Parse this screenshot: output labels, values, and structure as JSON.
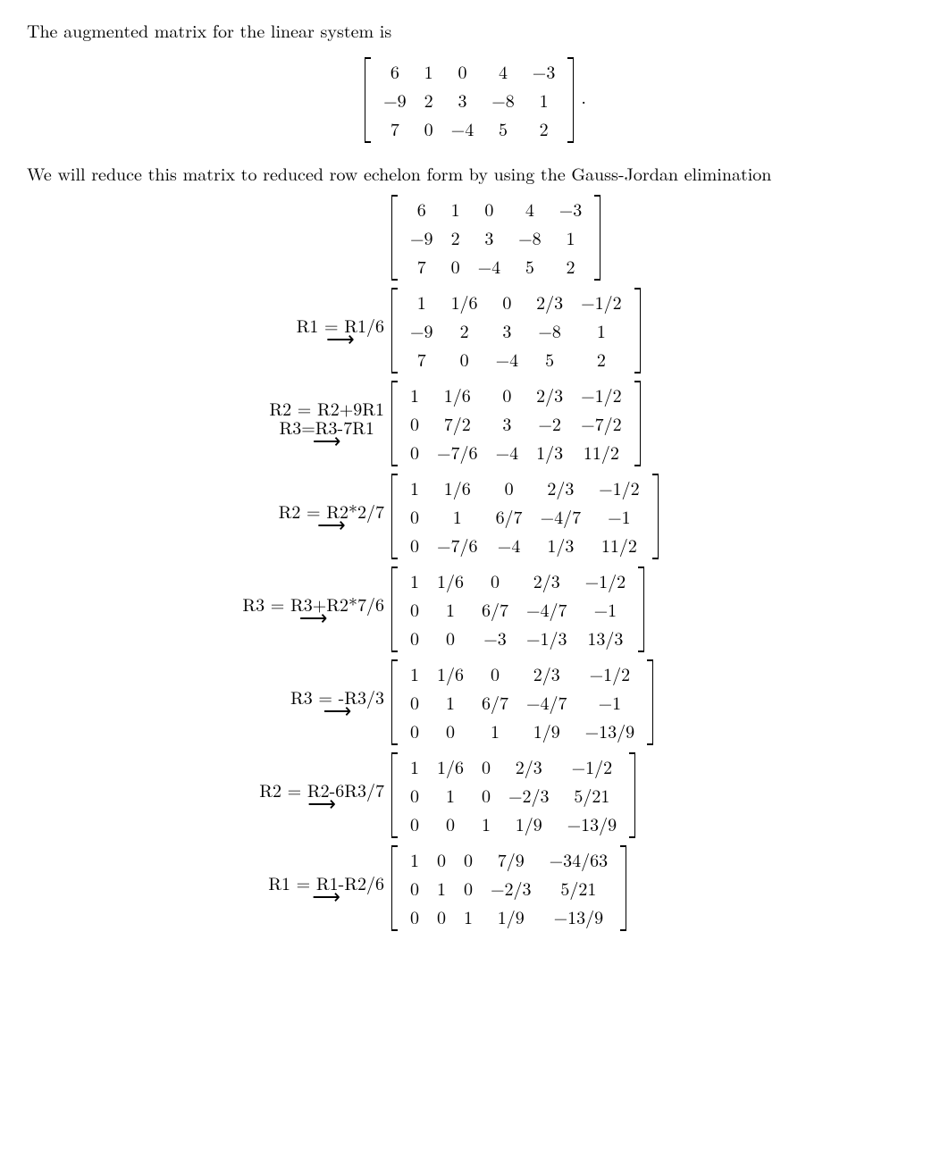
{
  "intro1": "The augmented matrix for the linear system is",
  "intro2": "We will reduce this matrix to reduced row echelon form by using the Gauss-Jordan elimination",
  "period": ".",
  "mat0": [
    [
      "6",
      "1",
      "0",
      "4",
      "−3"
    ],
    [
      "−9",
      "2",
      "3",
      "−8",
      "1"
    ],
    [
      "7",
      "0",
      "−4",
      "5",
      "2"
    ]
  ],
  "steps": [
    {
      "ops": [],
      "mat": [
        [
          "6",
          "1",
          "0",
          "4",
          "−3"
        ],
        [
          "−9",
          "2",
          "3",
          "−8",
          "1"
        ],
        [
          "7",
          "0",
          "−4",
          "5",
          "2"
        ]
      ]
    },
    {
      "ops": [
        "R1 = R1/6"
      ],
      "mat": [
        [
          "1",
          "1/6",
          "0",
          "2/3",
          "−1/2"
        ],
        [
          "−9",
          "2",
          "3",
          "−8",
          "1"
        ],
        [
          "7",
          "0",
          "−4",
          "5",
          "2"
        ]
      ]
    },
    {
      "ops": [
        "R2 = R2+9R1",
        "R3=R3-7R1"
      ],
      "mat": [
        [
          "1",
          "1/6",
          "0",
          "2/3",
          "−1/2"
        ],
        [
          "0",
          "7/2",
          "3",
          "−2",
          "−7/2"
        ],
        [
          "0",
          "−7/6",
          "−4",
          "1/3",
          "11/2"
        ]
      ]
    },
    {
      "ops": [
        "R2 = R2*2/7"
      ],
      "mat": [
        [
          "1",
          "1/6",
          "0",
          "2/3",
          "−1/2"
        ],
        [
          "0",
          "1",
          "6/7",
          "−4/7",
          "−1"
        ],
        [
          "0",
          "−7/6",
          "−4",
          "1/3",
          "11/2"
        ]
      ]
    },
    {
      "ops": [
        "R3 = R3+R2*7/6"
      ],
      "mat": [
        [
          "1",
          "1/6",
          "0",
          "2/3",
          "−1/2"
        ],
        [
          "0",
          "1",
          "6/7",
          "−4/7",
          "−1"
        ],
        [
          "0",
          "0",
          "−3",
          "−1/3",
          "13/3"
        ]
      ]
    },
    {
      "ops": [
        "R3 = -R3/3"
      ],
      "mat": [
        [
          "1",
          "1/6",
          "0",
          "2/3",
          "−1/2"
        ],
        [
          "0",
          "1",
          "6/7",
          "−4/7",
          "−1"
        ],
        [
          "0",
          "0",
          "1",
          "1/9",
          "−13/9"
        ]
      ]
    },
    {
      "ops": [
        "R2 = R2-6R3/7"
      ],
      "mat": [
        [
          "1",
          "1/6",
          "0",
          "2/3",
          "−1/2"
        ],
        [
          "0",
          "1",
          "0",
          "−2/3",
          "5/21"
        ],
        [
          "0",
          "0",
          "1",
          "1/9",
          "−13/9"
        ]
      ]
    },
    {
      "ops": [
        "R1 = R1-R2/6"
      ],
      "mat": [
        [
          "1",
          "0",
          "0",
          "7/9",
          "−34/63"
        ],
        [
          "0",
          "1",
          "0",
          "−2/3",
          "5/21"
        ],
        [
          "0",
          "0",
          "1",
          "1/9",
          "−13/9"
        ]
      ]
    }
  ]
}
